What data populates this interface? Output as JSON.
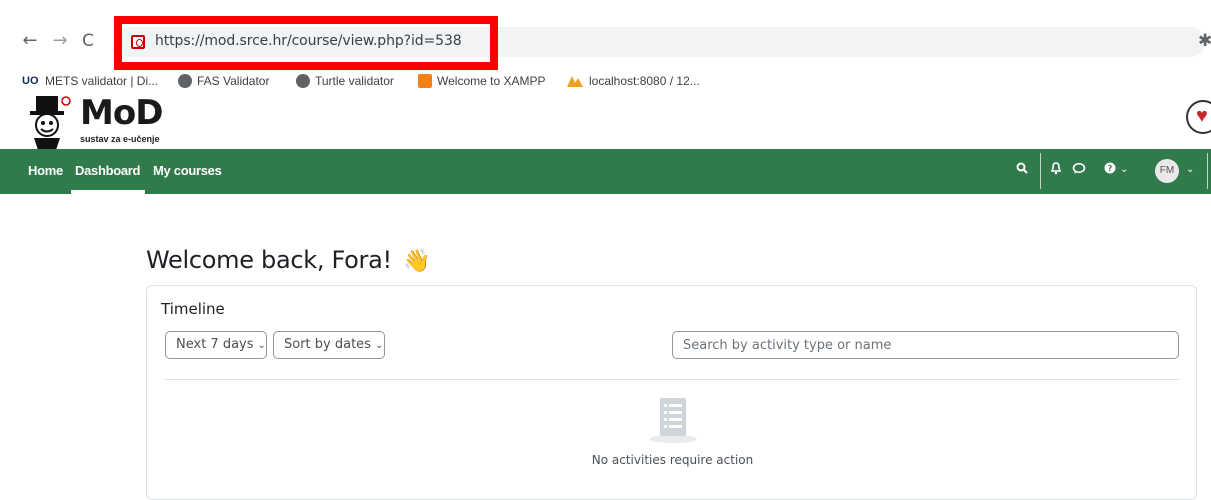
{
  "browser": {
    "url": "https://mod.srce.hr/course/view.php?id=538",
    "bookmarks": [
      "METS validator | Di...",
      "FAS Validator",
      "Turtle validator",
      "Welcome to XAMPP",
      "localhost:8080 / 12..."
    ]
  },
  "site": {
    "logo_text": "MoD",
    "logo_subtitle": "sustav za e-učenje"
  },
  "navbar": {
    "links": [
      "Home",
      "Dashboard",
      "My courses"
    ],
    "active": "Dashboard",
    "avatar_initials": "FM",
    "icons": [
      "search-icon",
      "bell-icon",
      "chat-icon",
      "help-icon"
    ]
  },
  "page": {
    "welcome": "Welcome back, Fora!",
    "wave_emoji": "👋"
  },
  "timeline": {
    "title": "Timeline",
    "filter_label": "Next 7 days",
    "sort_label": "Sort by dates",
    "search_placeholder": "Search by activity type or name",
    "empty_message": "No activities require action"
  },
  "colors": {
    "navbar": "#317a4b",
    "highlight": "#ff0000"
  }
}
